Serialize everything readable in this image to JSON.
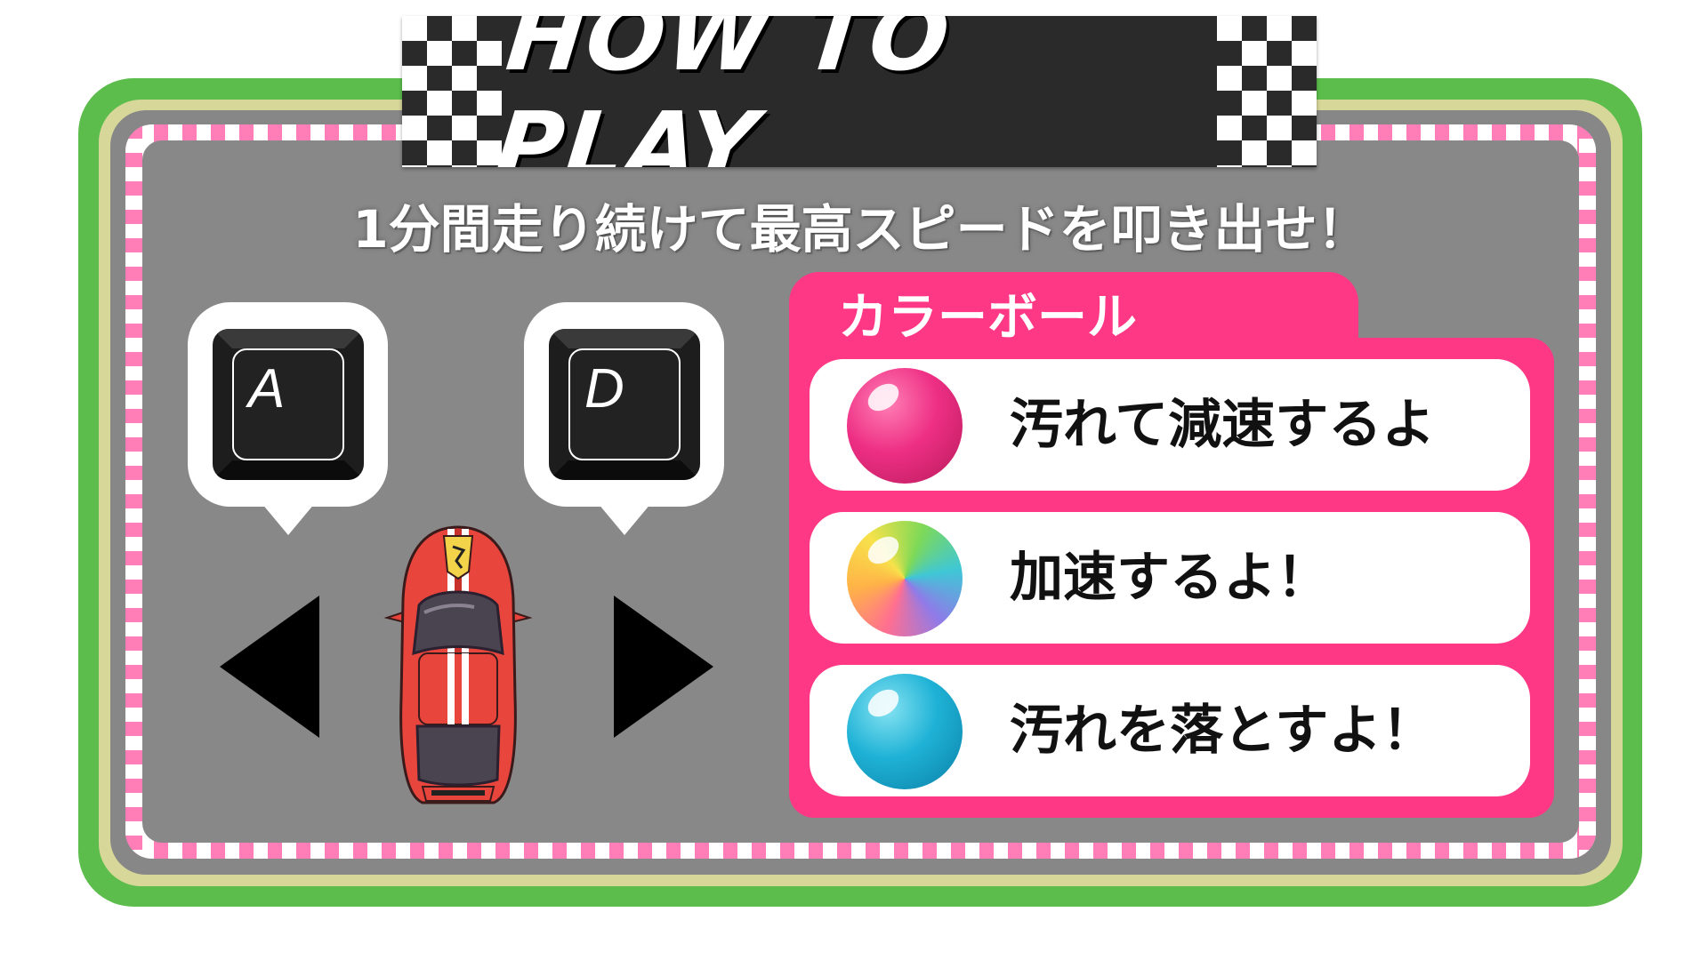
{
  "title": "HOW TO PLAY",
  "subtitle": "1分間走り続けて最高スピードを叩き出せ！",
  "keys": {
    "left": {
      "letter": "A",
      "arrow_icon": "left-triangle-icon"
    },
    "right": {
      "letter": "D",
      "arrow_icon": "right-triangle-icon"
    }
  },
  "panel": {
    "title": "カラーボール",
    "items": [
      {
        "text": "汚れて減速するよ",
        "ball": "pink-ball-icon",
        "color": "#e8317a"
      },
      {
        "text": "加速するよ！",
        "ball": "rainbow-ball-icon",
        "color": "#6fd24a"
      },
      {
        "text": "汚れを落とすよ！",
        "ball": "cyan-ball-icon",
        "color": "#1fb2d6"
      }
    ]
  },
  "colors": {
    "track_green": "#5cbd4c",
    "asphalt": "#888888",
    "stripe_pink": "#ff7eb8",
    "panel_pink": "#ff3885",
    "banner_dark": "#2a2a2a"
  }
}
